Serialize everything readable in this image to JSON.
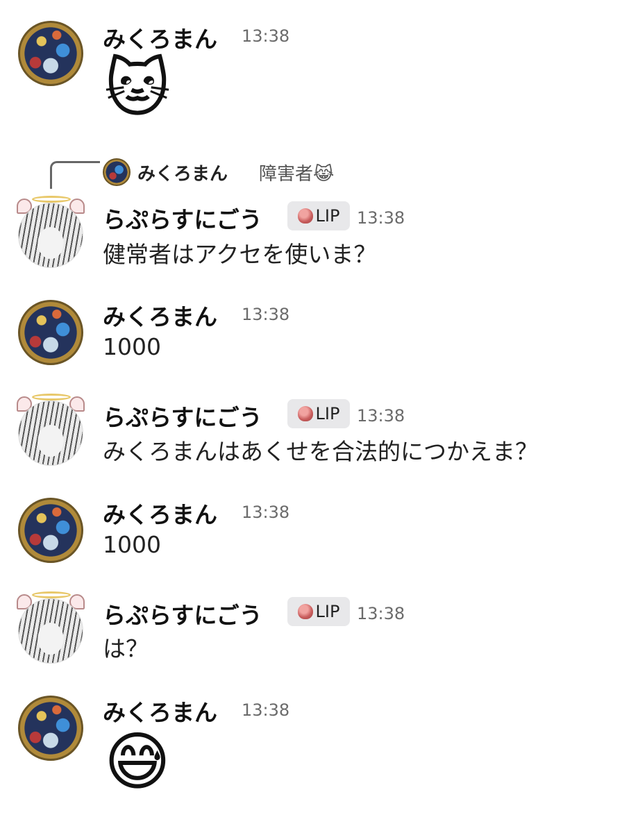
{
  "reply": {
    "name": "みくろまん",
    "text": "障害者😹"
  },
  "messages": [
    {
      "id": "m1",
      "author": "みくろまん",
      "time": "13:38",
      "emoji": "🐱"
    },
    {
      "id": "m2",
      "author": "らぷらすにごう",
      "badge": "LIP",
      "time": "13:38",
      "text": "健常者はアクセを使いま？"
    },
    {
      "id": "m3",
      "author": "みくろまん",
      "time": "13:38",
      "text": "1000"
    },
    {
      "id": "m4",
      "author": "らぷらすにごう",
      "badge": "LIP",
      "time": "13:38",
      "text": "みくろまんはあくせを合法的につかえま？"
    },
    {
      "id": "m5",
      "author": "みくろまん",
      "time": "13:38",
      "text": "1000"
    },
    {
      "id": "m6",
      "author": "らぷらすにごう",
      "badge": "LIP",
      "time": "13:38",
      "text": "は？"
    },
    {
      "id": "m7",
      "author": "みくろまん",
      "time": "13:38",
      "emoji": "😅"
    }
  ],
  "colors": {
    "timestamp": "#6b6b6b",
    "badge_bg": "#e8e8ea",
    "halo": "#e8c86a"
  }
}
